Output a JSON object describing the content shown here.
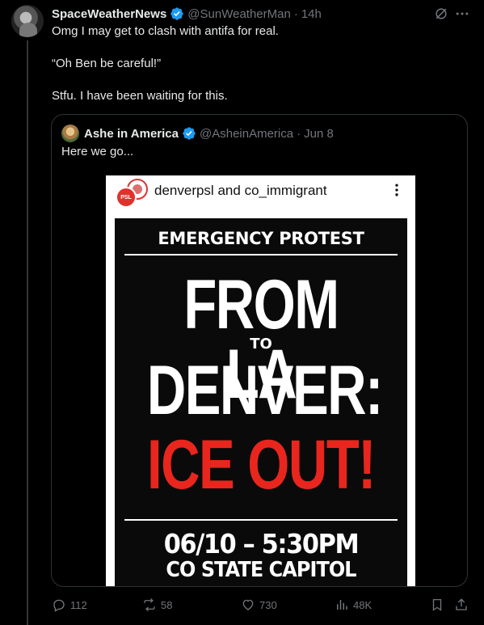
{
  "tweet": {
    "author_name": "SpaceWeatherNews",
    "handle": "@SunWeatherMan",
    "separator": "·",
    "time": "14h",
    "lines": [
      "Omg I may get to clash with antifa for real.",
      "“Oh Ben be careful!”",
      "Stfu. I have been waiting for this."
    ]
  },
  "quote": {
    "author_name": "Ashe in America",
    "handle": "@AsheinAmerica",
    "separator": "·",
    "time": "Jun 8",
    "text": "Here we go..."
  },
  "media": {
    "accounts_a": "denverpsl",
    "accounts_and": "and",
    "accounts_b": "co_immigrant",
    "logo1_text": "PSL",
    "poster": {
      "header": "EMERGENCY PROTEST",
      "line1": "FROM LA",
      "to": "TO",
      "line2": "DENVER:",
      "line3": "ICE OUT!",
      "date": "06/10 – 5:30PM",
      "place": "CO STATE CAPITOL"
    },
    "colors": {
      "accent_red": "#e8261e"
    }
  },
  "actions": {
    "replies": "112",
    "reposts": "58",
    "likes": "730",
    "views": "48K"
  },
  "colors": {
    "verified_blue": "#1d9bf0",
    "muted": "#71767b",
    "text": "#e7e9ea",
    "background": "#000000"
  }
}
